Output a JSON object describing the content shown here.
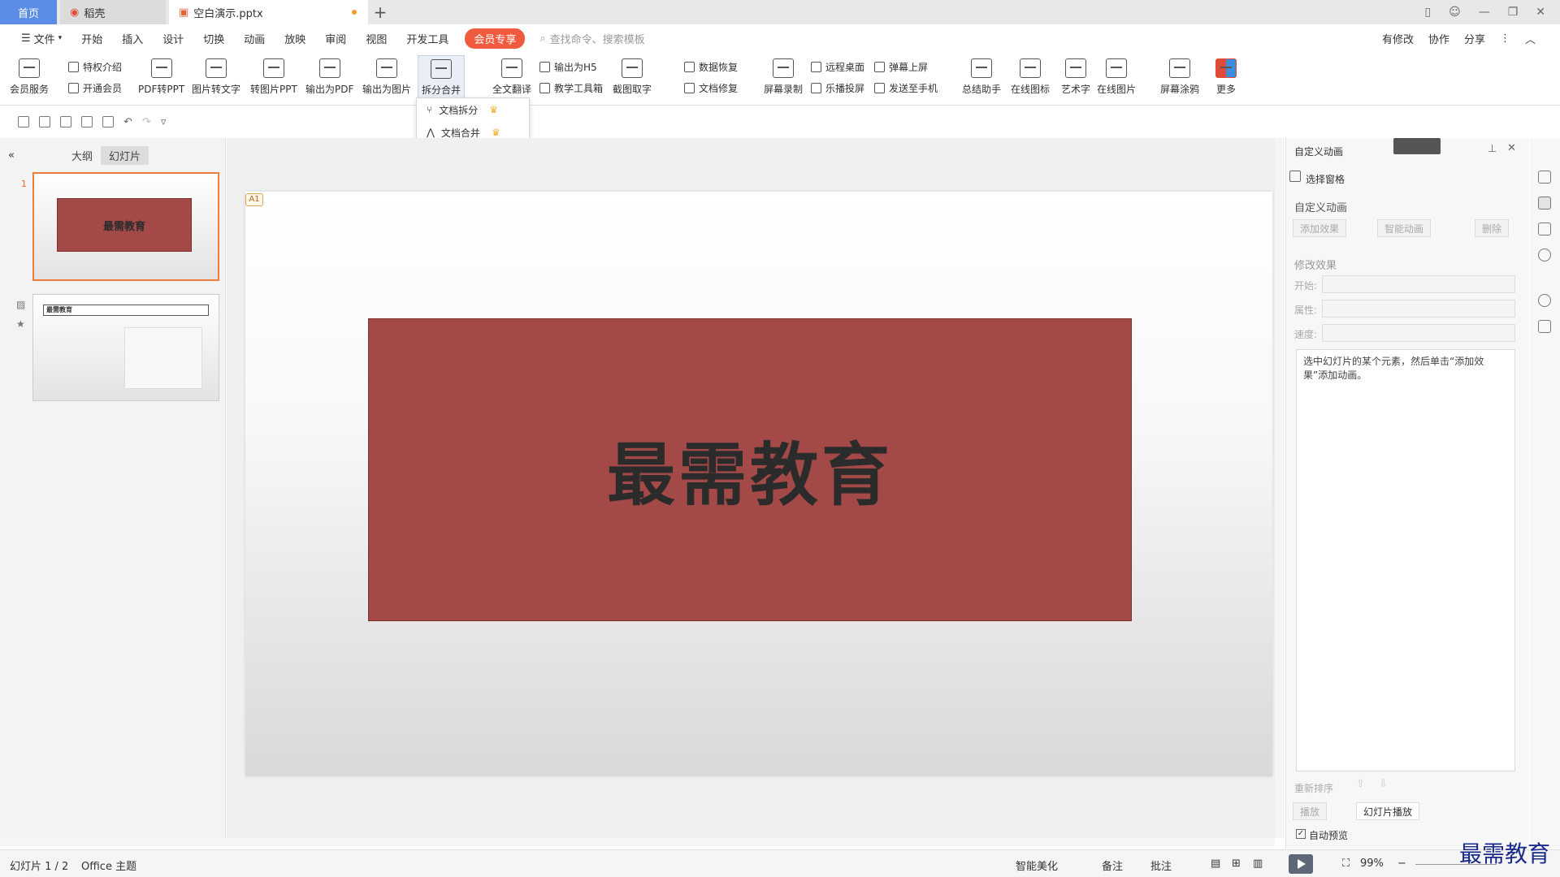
{
  "tabs": {
    "home": "首页",
    "docer": "稻壳",
    "file": "空白演示.pptx"
  },
  "menu": {
    "file": "文件",
    "items": [
      "开始",
      "插入",
      "设计",
      "切换",
      "动画",
      "放映",
      "审阅",
      "视图",
      "开发工具"
    ],
    "vip": "会员专享",
    "search_placeholder": "查找命令、搜索模板",
    "right": [
      "有修改",
      "协作",
      "分享"
    ]
  },
  "ribbon": {
    "member_service": "会员服务",
    "privilege": "特权介绍",
    "open_vip": "开通会员",
    "pdf_to_ppt": "PDF转PPT",
    "img_to_text": "图片转文字",
    "to_img_ppt": "转图片PPT",
    "export_pdf": "输出为PDF",
    "export_img": "输出为图片",
    "split_merge": "拆分合并",
    "translate": "全文翻译",
    "export_h5": "输出为H5",
    "teaching_tools": "教学工具箱",
    "screenshot_ocr": "截图取字",
    "data_recovery": "数据恢复",
    "doc_repair": "文档修复",
    "screen_record": "屏幕录制",
    "remote_desktop": "远程桌面",
    "le_cast": "乐播投屏",
    "barrage": "弹幕上屏",
    "send_phone": "发送至手机",
    "summary": "总结助手",
    "online_icon": "在线图标",
    "art_text": "艺术字",
    "online_img": "在线图片",
    "screen_draw": "屏幕涂鸦",
    "more": "更多"
  },
  "dropdown": {
    "split": "文档拆分",
    "merge": "文档合并"
  },
  "left_pane": {
    "tab_outline": "大纲",
    "tab_slides": "幻灯片",
    "slide1_title": "最需教育",
    "slide1_num": "1",
    "slide2_title": "最需教育"
  },
  "slide": {
    "title": "最需教育",
    "badge": "A1"
  },
  "right_pane": {
    "header": "自定义动画",
    "select_pane": "选择窗格",
    "custom_anim": "自定义动画",
    "add_effect": "添加效果",
    "smart_anim": "智能动画",
    "delete": "删除",
    "modify_effect": "修改效果",
    "start": "开始:",
    "property": "属性:",
    "speed": "速度:",
    "hint": "选中幻灯片的某个元素，然后单击“添加效果”添加动画。",
    "reorder": "重新排序",
    "play": "播放",
    "slideshow": "幻灯片播放",
    "auto_preview": "自动预览"
  },
  "status": {
    "slide_counter": "幻灯片 1 / 2",
    "theme": "Office 主题",
    "smart_beautify": "智能美化",
    "notes": "备注",
    "comments": "批注",
    "zoom": "99%"
  },
  "watermark": "最需教育"
}
